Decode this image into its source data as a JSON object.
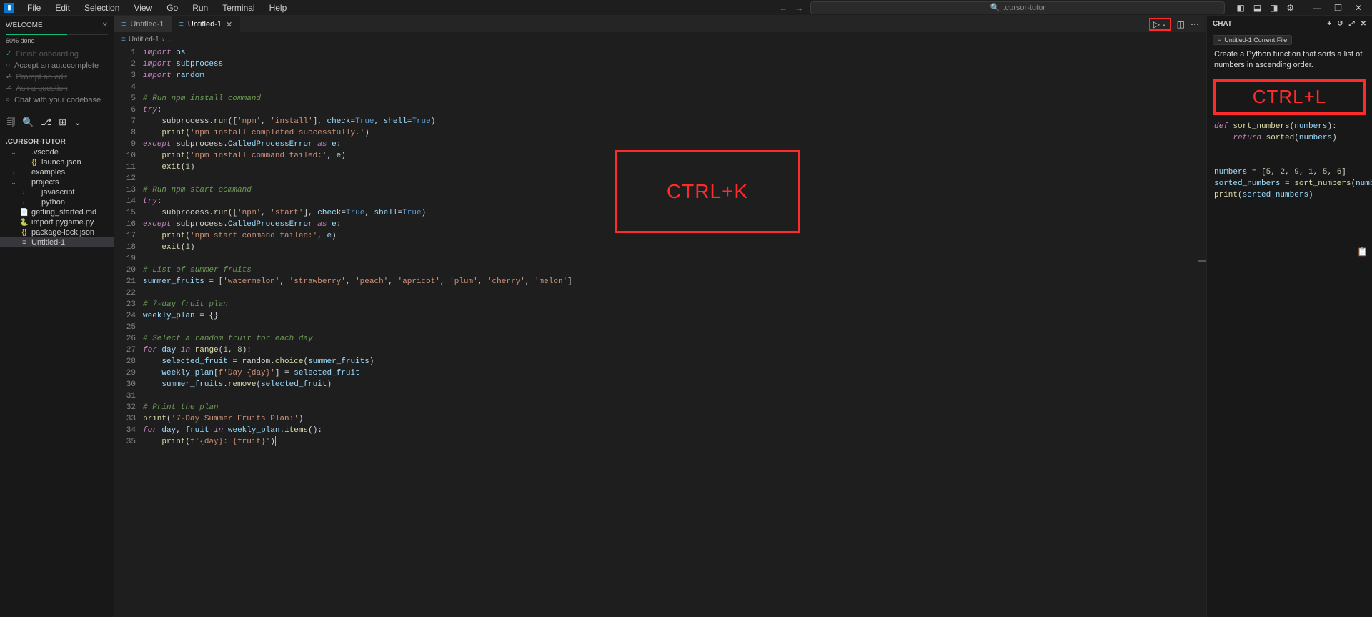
{
  "menu": [
    "File",
    "Edit",
    "Selection",
    "View",
    "Go",
    "Run",
    "Terminal",
    "Help"
  ],
  "search_placeholder": ".cursor-tutor",
  "window_controls": {
    "minimize": "—",
    "maximize": "❐",
    "close": "✕"
  },
  "layout_icons": [
    "panel-left-icon",
    "panel-bottom-icon",
    "panel-right-icon",
    "gear-icon"
  ],
  "welcome": {
    "title": "WELCOME",
    "progress": "60% done",
    "items": [
      {
        "label": "Finish onboarding",
        "done": true
      },
      {
        "label": "Accept an autocomplete",
        "done": false
      },
      {
        "label": "Prompt an edit",
        "done": true
      },
      {
        "label": "Ask a question",
        "done": true
      },
      {
        "label": "Chat with your codebase",
        "done": false
      }
    ]
  },
  "explorer_label": ".CURSOR-TUTOR",
  "tree": [
    {
      "kind": "folder",
      "label": ".vscode",
      "indent": 1,
      "open": true
    },
    {
      "kind": "file",
      "label": "launch.json",
      "indent": 2,
      "icon": "json"
    },
    {
      "kind": "folder",
      "label": "examples",
      "indent": 1,
      "open": false
    },
    {
      "kind": "folder",
      "label": "projects",
      "indent": 1,
      "open": true
    },
    {
      "kind": "folder",
      "label": "javascript",
      "indent": 2,
      "open": false
    },
    {
      "kind": "folder",
      "label": "python",
      "indent": 2,
      "open": false
    },
    {
      "kind": "file",
      "label": "getting_started.md",
      "indent": 1,
      "icon": "md"
    },
    {
      "kind": "file",
      "label": "import pygame.py",
      "indent": 1,
      "icon": "py"
    },
    {
      "kind": "file",
      "label": "package-lock.json",
      "indent": 1,
      "icon": "json"
    },
    {
      "kind": "file",
      "label": "Untitled-1",
      "indent": 1,
      "icon": "txt",
      "selected": true
    }
  ],
  "tabs": [
    {
      "label": "Untitled-1",
      "active": false,
      "icon": "txt"
    },
    {
      "label": "Untitled-1",
      "active": true,
      "icon": "txt",
      "close": true
    }
  ],
  "breadcrumb": [
    "Untitled-1",
    "..."
  ],
  "code_lines": [
    {
      "n": 1,
      "html": "<span class='kw'>import</span> <span class='va'>os</span>"
    },
    {
      "n": 2,
      "html": "<span class='kw'>import</span> <span class='va'>subprocess</span>"
    },
    {
      "n": 3,
      "html": "<span class='kw'>import</span> <span class='va'>random</span>"
    },
    {
      "n": 4,
      "html": ""
    },
    {
      "n": 5,
      "html": "<span class='cm'># Run npm install command</span>"
    },
    {
      "n": 6,
      "html": "<span class='kw'>try</span>:"
    },
    {
      "n": 7,
      "html": "    subprocess.<span class='fn'>run</span>([<span class='st'>'npm'</span>, <span class='st'>'install'</span>], <span class='va'>check</span>=<span class='bl'>True</span>, <span class='va'>shell</span>=<span class='bl'>True</span>)"
    },
    {
      "n": 8,
      "html": "    <span class='fn'>print</span>(<span class='st'>'npm install completed successfully.'</span>)"
    },
    {
      "n": 9,
      "html": "<span class='kw'>except</span> subprocess.<span class='va'>CalledProcessError</span> <span class='kw'>as</span> <span class='va'>e</span>:"
    },
    {
      "n": 10,
      "html": "    <span class='fn'>print</span>(<span class='st'>'npm install command failed:'</span>, <span class='va'>e</span>)"
    },
    {
      "n": 11,
      "html": "    <span class='fn'>exit</span>(<span class='nm'>1</span>)"
    },
    {
      "n": 12,
      "html": ""
    },
    {
      "n": 13,
      "html": "<span class='cm'># Run npm start command</span>"
    },
    {
      "n": 14,
      "html": "<span class='kw'>try</span>:"
    },
    {
      "n": 15,
      "html": "    subprocess.<span class='fn'>run</span>([<span class='st'>'npm'</span>, <span class='st'>'start'</span>], <span class='va'>check</span>=<span class='bl'>True</span>, <span class='va'>shell</span>=<span class='bl'>True</span>)"
    },
    {
      "n": 16,
      "html": "<span class='kw'>except</span> subprocess.<span class='va'>CalledProcessError</span> <span class='kw'>as</span> <span class='va'>e</span>:"
    },
    {
      "n": 17,
      "html": "    <span class='fn'>print</span>(<span class='st'>'npm start command failed:'</span>, <span class='va'>e</span>)"
    },
    {
      "n": 18,
      "html": "    <span class='fn'>exit</span>(<span class='nm'>1</span>)"
    },
    {
      "n": 19,
      "html": ""
    },
    {
      "n": 20,
      "html": "<span class='cm'># List of summer fruits</span>"
    },
    {
      "n": 21,
      "html": "<span class='va'>summer_fruits</span> = [<span class='st'>'watermelon'</span>, <span class='st'>'strawberry'</span>, <span class='st'>'peach'</span>, <span class='st'>'apricot'</span>, <span class='st'>'plum'</span>, <span class='st'>'cherry'</span>, <span class='st'>'melon'</span>]"
    },
    {
      "n": 22,
      "html": ""
    },
    {
      "n": 23,
      "html": "<span class='cm'># 7-day fruit plan</span>"
    },
    {
      "n": 24,
      "html": "<span class='va'>weekly_plan</span> = {}"
    },
    {
      "n": 25,
      "html": ""
    },
    {
      "n": 26,
      "html": "<span class='cm'># Select a random fruit for each day</span>"
    },
    {
      "n": 27,
      "html": "<span class='kw'>for</span> <span class='va'>day</span> <span class='kw'>in</span> <span class='fn'>range</span>(<span class='nm'>1</span>, <span class='nm'>8</span>):"
    },
    {
      "n": 28,
      "html": "    <span class='va'>selected_fruit</span> = random.<span class='fn'>choice</span>(<span class='va'>summer_fruits</span>)"
    },
    {
      "n": 29,
      "html": "    <span class='va'>weekly_plan</span>[<span class='st'>f'Day {day}'</span>] = <span class='va'>selected_fruit</span>"
    },
    {
      "n": 30,
      "html": "    <span class='va'>summer_fruits</span>.<span class='fn'>remove</span>(<span class='va'>selected_fruit</span>)"
    },
    {
      "n": 31,
      "html": ""
    },
    {
      "n": 32,
      "html": "<span class='cm'># Print the plan</span>"
    },
    {
      "n": 33,
      "html": "<span class='fn'>print</span>(<span class='st'>'7-Day Summer Fruits Plan:'</span>)"
    },
    {
      "n": 34,
      "html": "<span class='kw'>for</span> <span class='va'>day</span>, <span class='va'>fruit</span> <span class='kw'>in</span> <span class='va'>weekly_plan</span>.<span class='fn'>items</span>():"
    },
    {
      "n": 35,
      "html": "    <span class='fn'>print</span>(<span class='st'>f'{day}: {fruit}'</span>)<span class='cursor-caret'></span>"
    }
  ],
  "overlay_k": "CTRL+K",
  "overlay_l": "CTRL+L",
  "chat": {
    "title": "CHAT",
    "chip": "Untitled-1  Current File",
    "prompt": "Create a Python function that sorts a list of numbers in ascending order.",
    "code_lines": [
      "<span class='kw'>def</span> <span class='fn'>sort_numbers</span>(<span class='va'>numbers</span>):",
      "    <span class='kw'>return</span> <span class='fn'>sorted</span>(<span class='va'>numbers</span>)",
      "",
      "",
      "<span class='va'>numbers</span> = [<span class='nm'>5</span>, <span class='nm'>2</span>, <span class='nm'>9</span>, <span class='nm'>1</span>, <span class='nm'>5</span>, <span class='nm'>6</span>]",
      "<span class='va'>sorted_numbers</span> = <span class='fn'>sort_numbers</span>(<span class='va'>numbers</span>)",
      "<span class='fn'>print</span>(<span class='va'>sorted_numbers</span>)"
    ]
  }
}
